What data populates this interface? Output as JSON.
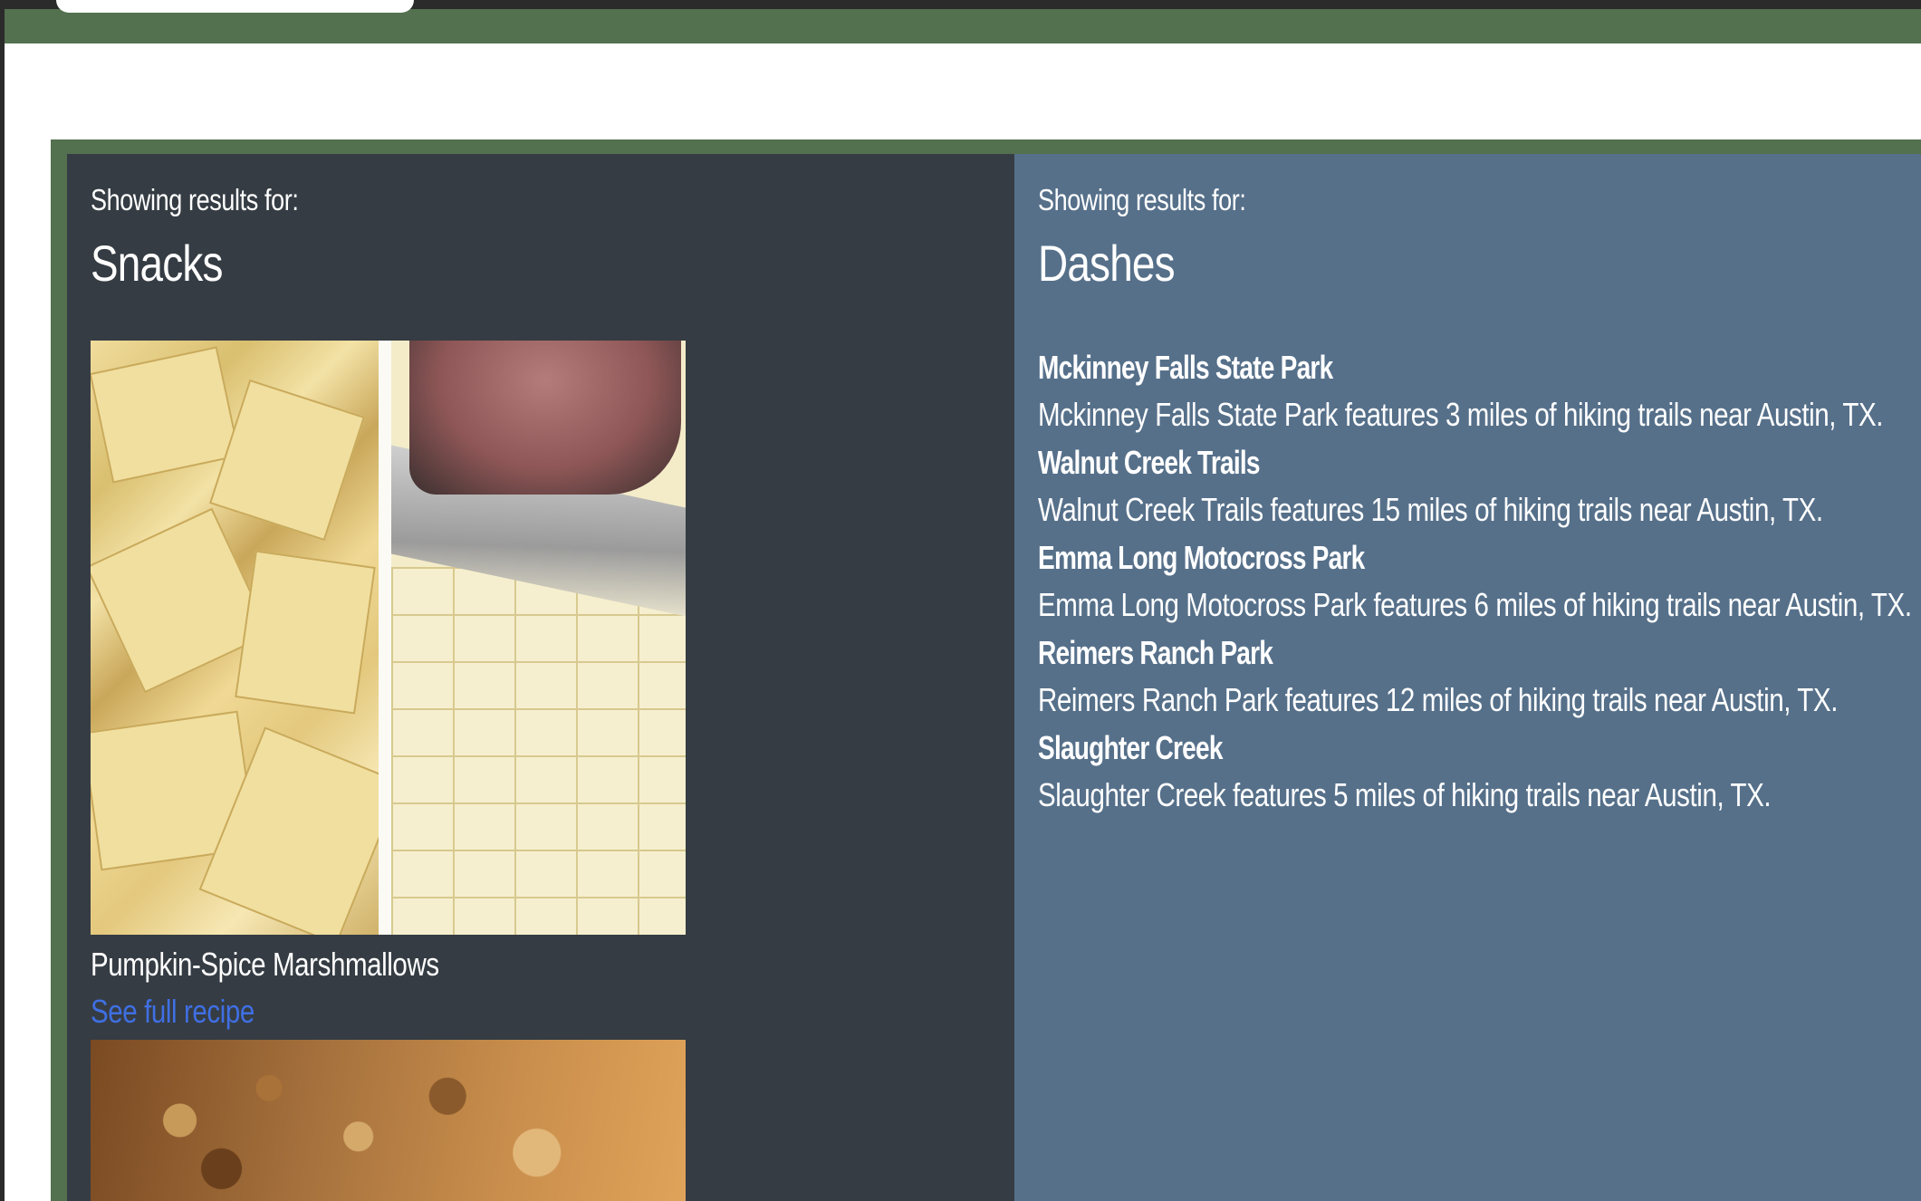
{
  "snacks_panel": {
    "eyebrow": "Showing results for:",
    "heading": "Snacks",
    "recipes": [
      {
        "title": "Pumpkin-Spice Marshmallows",
        "link_label": "See full recipe"
      }
    ]
  },
  "dashes_panel": {
    "eyebrow": "Showing results for:",
    "heading": "Dashes",
    "trails": [
      {
        "name": "Mckinney Falls State Park",
        "description": "Mckinney Falls State Park features 3 miles of hiking trails near Austin, TX."
      },
      {
        "name": "Walnut Creek Trails",
        "description": "Walnut Creek Trails features 15 miles of hiking trails near Austin, TX."
      },
      {
        "name": "Emma Long Motocross Park",
        "description": "Emma Long Motocross Park features 6 miles of hiking trails near Austin, TX."
      },
      {
        "name": "Reimers Ranch Park",
        "description": "Reimers Ranch Park features 12 miles of hiking trails near Austin, TX."
      },
      {
        "name": "Slaughter Creek",
        "description": "Slaughter Creek features 5 miles of hiking trails near Austin, TX."
      }
    ]
  },
  "colors": {
    "header_green": "#53704f",
    "snacks_bg": "#353c43",
    "dashes_bg": "#56708a",
    "link_blue": "#3f6fe3"
  }
}
